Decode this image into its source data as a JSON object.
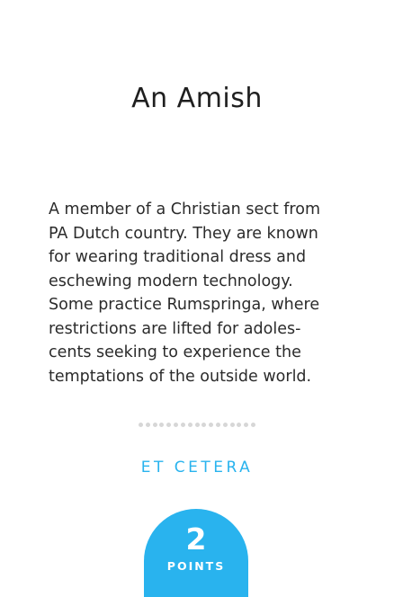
{
  "card": {
    "title": "An Amish",
    "description": "A member of a Christian sect from\nPA Dutch country. They are known\nfor wearing traditional dress and\neschewing modern technology.\nSome practice Rumspringa, where\nrestrictions are lifted for adoles-\ncents seeking to experience the\ntemptations of the outside world.",
    "category": "ET CETERA",
    "points_value": "2",
    "points_label": "POINTS"
  },
  "colors": {
    "accent": "#29b3ee",
    "text": "#2b2b2b",
    "divider_dot": "#d7d7d7",
    "background": "#ffffff"
  }
}
